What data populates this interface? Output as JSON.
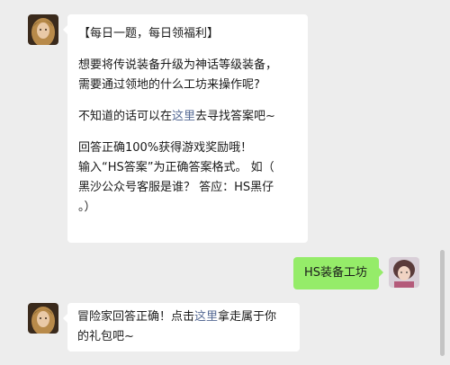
{
  "messages": [
    {
      "side": "left",
      "lines": [
        {
          "text": "【每日一题，每日领福利】"
        },
        {
          "blank": true
        },
        {
          "text": "想要将传说装备升级为神话等级装备，"
        },
        {
          "text": "需要通过领地的什么工坊来操作呢?"
        },
        {
          "blank": true
        },
        {
          "pre": "不知道的话可以在",
          "link": "这里",
          "post": "去寻找答案吧~"
        },
        {
          "blank": true
        },
        {
          "text": "回答正确100%获得游戏奖励哦！"
        },
        {
          "text": "输入“HS答案”为正确答案格式。 如（"
        },
        {
          "text": "黑沙公众号客服是谁？ 答应：HS黑仔"
        },
        {
          "text": "。）"
        }
      ]
    },
    {
      "side": "right",
      "text": "HS装备工坊"
    },
    {
      "side": "left",
      "line1_pre": "冒险家回答正确！点击",
      "line1_link": "这里",
      "line1_post": "拿走属于你",
      "line2": "的礼包吧~"
    }
  ],
  "colors": {
    "background": "#ededed",
    "bubble_left": "#ffffff",
    "bubble_right": "#95ec69",
    "link": "#576b95"
  }
}
